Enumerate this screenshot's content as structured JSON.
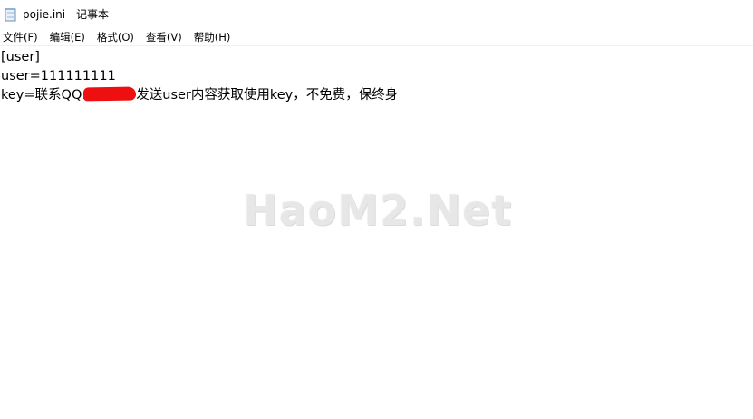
{
  "window": {
    "title": "pojie.ini - 记事本"
  },
  "menu": {
    "items": [
      {
        "label": "文件(F)"
      },
      {
        "label": "编辑(E)"
      },
      {
        "label": "格式(O)"
      },
      {
        "label": "查看(V)"
      },
      {
        "label": "帮助(H)"
      }
    ]
  },
  "editor": {
    "lines": [
      "[user]",
      "user=111111111"
    ],
    "key_line": {
      "prefix": "key=联系QQ:",
      "suffix": "发送user内容获取使用key，不免费，保终身"
    }
  },
  "watermark": {
    "text": "HaoM2.Net"
  },
  "colors": {
    "redaction": "#ee1010",
    "background": "#ffffff",
    "text": "#000000"
  },
  "icons": {
    "app": "notepad-icon"
  }
}
